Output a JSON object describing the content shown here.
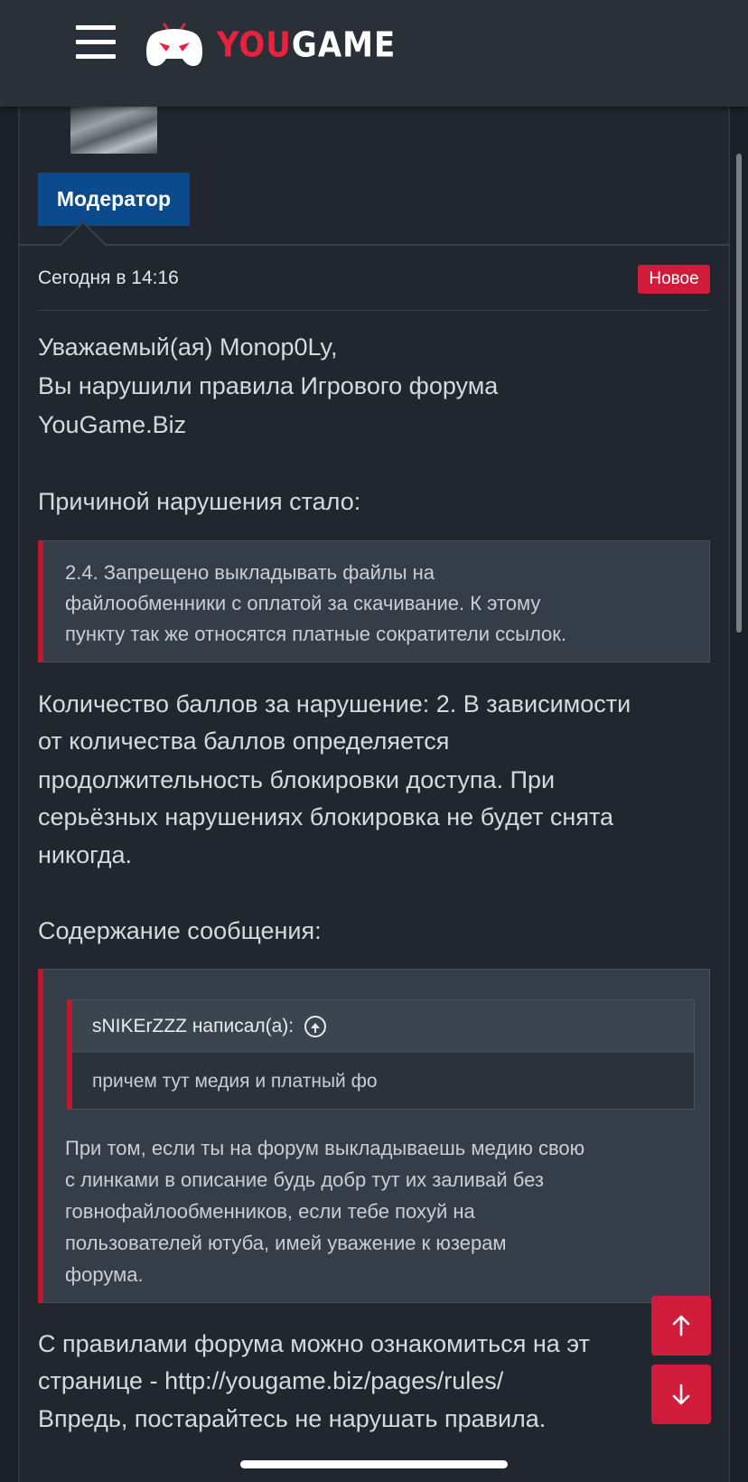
{
  "header": {
    "menu_icon": "hamburger-menu-icon",
    "logo_icon": "gamepad-logo-icon",
    "logo_part1": "YOU",
    "logo_part2": "GAME",
    "accent_color": "#e8213f"
  },
  "author": {
    "avatar": "user-avatar",
    "role": "Модератор",
    "role_color": "#0b4a8c"
  },
  "post": {
    "date": "Сегодня в 14:16",
    "badge": "Новое",
    "badge_color": "#d11b3a",
    "greeting": "Уважаемый(ая) Monop0Ly,",
    "violation_line1": "Вы нарушили правила Игрового форума",
    "violation_line2": "YouGame.Biz",
    "reason_label": "Причиной нарушения стало:",
    "rule_quote": [
      "2.4. Запрещено выкладывать файлы на",
      "файлообменники с оплатой за скачивание. К этому",
      "пункту так же относятся платные сократители ссылок."
    ],
    "points": [
      "Количество баллов за нарушение: 2. В зависимости",
      "от количества баллов определяется",
      "продолжительность блокировки доступа. При",
      "серьёзных нарушениях блокировка не будет снята",
      "никогда."
    ],
    "content_label": "Содержание сообщения:",
    "nested_quote": {
      "author": "sNIKErZZZ написал(а):",
      "text": "причем тут медия и платный фо"
    },
    "content_quote": [
      "При том, если ты на форум выкладываешь медию свою",
      "с линками в описание будь добр тут их заливай без",
      "говнофайлообменников, если тебе похуй на",
      "пользователей ютуба, имей уважение к юзерам",
      "форума."
    ],
    "footer": [
      "С правилами форума можно ознакомиться на эт",
      "странице - http://yougame.biz/pages/rules/",
      "Впредь, постарайтесь не нарушать правила."
    ]
  },
  "controls": {
    "scroll_up_icon": "arrow-up-icon",
    "scroll_down_icon": "arrow-down-icon"
  }
}
